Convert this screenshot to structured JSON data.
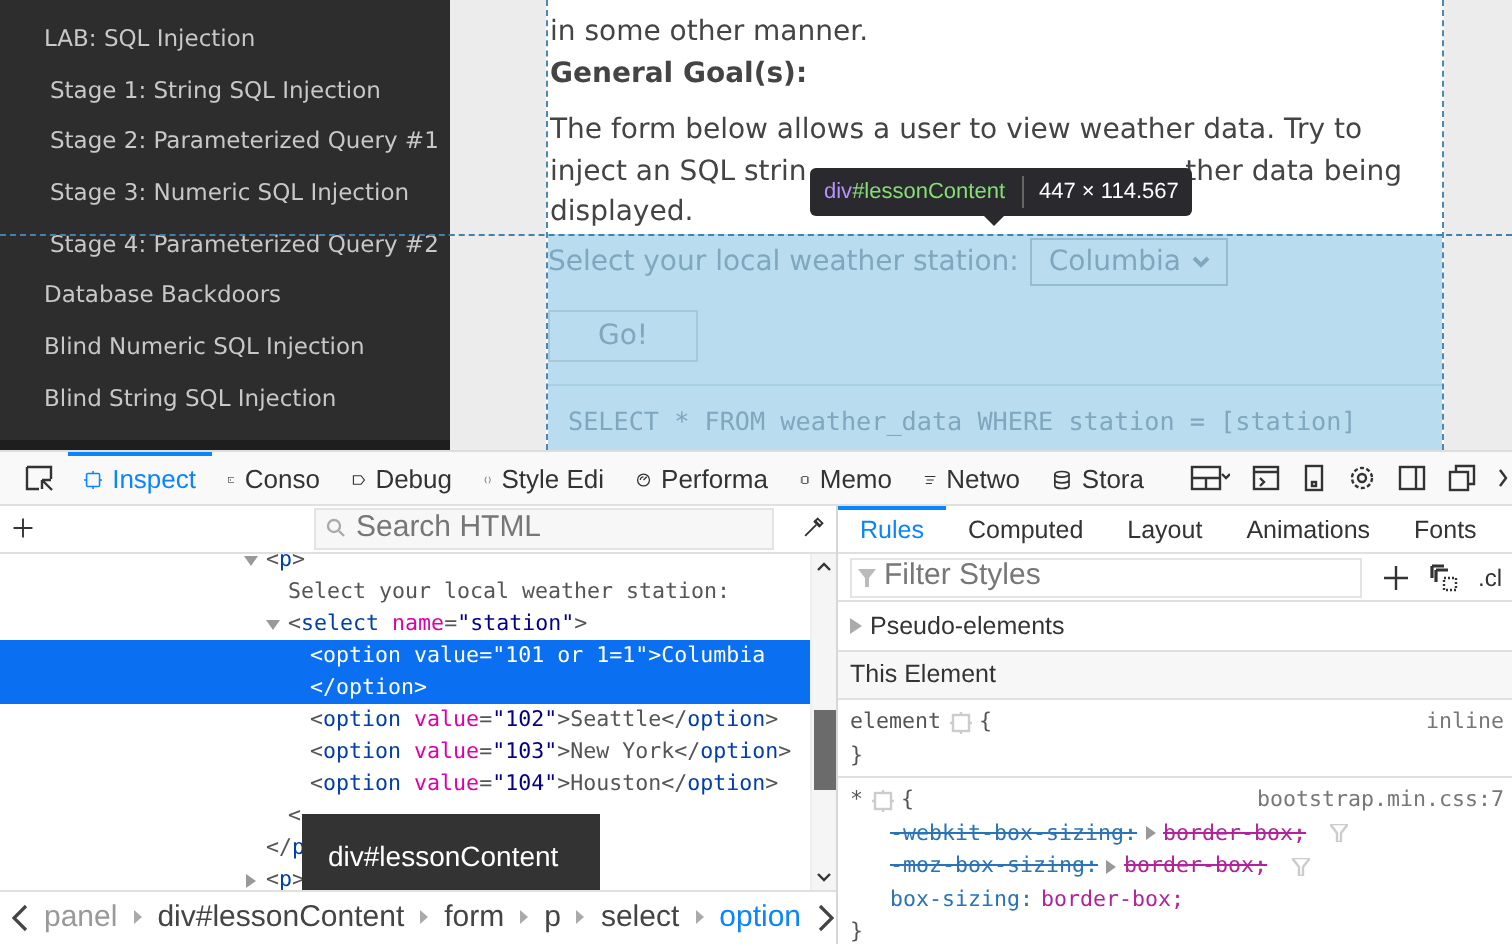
{
  "sidebar": {
    "items": [
      {
        "label": "LAB: SQL Injection",
        "children": [
          {
            "label": "Stage 1: String SQL Injection"
          },
          {
            "label": "Stage 2: Parameterized Query #1"
          },
          {
            "label": "Stage 3: Numeric SQL Injection"
          },
          {
            "label": "Stage 4: Parameterized Query #2"
          }
        ]
      },
      {
        "label": "Database Backdoors"
      },
      {
        "label": "Blind Numeric SQL Injection"
      },
      {
        "label": "Blind String SQL Injection"
      }
    ]
  },
  "lesson": {
    "text": "in some other manner.",
    "heading": "General Goal(s):",
    "paragraph_lines": [
      {
        "left": "The form below allows a user to view weather data. Try to"
      },
      {
        "left": "inject an SQL strin",
        "right": "ther data being"
      },
      {
        "left": "displayed."
      }
    ],
    "form": {
      "highlighted": true,
      "label": "Select your local weather station:",
      "station": "Columbia",
      "button": "Go!",
      "query": "SELECT * FROM weather_data WHERE station = [station]"
    }
  },
  "highlight_tooltip": {
    "tag": "div",
    "id": "#lessonContent",
    "size": "447 × 114.567"
  },
  "devtools": {
    "tabs": [
      {
        "label": "Inspect",
        "selected": true
      },
      {
        "label": "Conso",
        "selected": false
      },
      {
        "label": "Debug",
        "selected": false
      },
      {
        "label": "Style Edi",
        "selected": false
      },
      {
        "label": "Performa",
        "selected": false
      },
      {
        "label": "Memo",
        "selected": false
      },
      {
        "label": "Netwo",
        "selected": false
      },
      {
        "label": "Stora",
        "selected": false
      }
    ],
    "search_placeholder": "Search HTML",
    "markup": [
      {
        "open": "<p>",
        "expanded": true,
        "selected": false,
        "children": [
          {
            "text": "Select your local weather station:",
            "selected": false
          },
          {
            "open": "<select name=\"station\">",
            "expanded": true,
            "selected": false,
            "children": [
              {
                "open": "<option value=\"101 or 1=1\">",
                "content": "Columbia",
                "close_line": "</option>",
                "selected": true
              },
              {
                "open": "<option value=\"102\">",
                "content": "Seattle",
                "close": "</option>",
                "selected": false
              },
              {
                "open": "<option value=\"103\">",
                "content": "New York",
                "close": "</option>",
                "selected": false
              },
              {
                "open": "<option value=\"104\">",
                "content": "Houston",
                "close": "</option>",
                "selected": false
              }
            ],
            "end": "<"
          }
        ],
        "end": "</p"
      },
      {
        "open": "<p>",
        "expanded": false,
        "selected": false
      }
    ],
    "node_tooltip": "div#lessonContent",
    "breadcrumbs": [
      {
        "label": "panel",
        "selected": false
      },
      {
        "label": "div#lessonContent",
        "selected": false
      },
      {
        "label": "form",
        "selected": false
      },
      {
        "label": "p",
        "selected": false
      },
      {
        "label": "select",
        "selected": false
      },
      {
        "label": "option",
        "selected": true
      }
    ],
    "sidebar_tabs": [
      {
        "label": "Rules",
        "selected": true
      },
      {
        "label": "Computed",
        "selected": false
      },
      {
        "label": "Layout",
        "selected": false
      },
      {
        "label": "Animations",
        "selected": false
      },
      {
        "label": "Fonts",
        "selected": false
      }
    ],
    "filter_placeholder": "Filter Styles",
    "class_toggle": ".cl",
    "pseudo_elements": "Pseudo-elements",
    "section": "This Element",
    "rules": [
      {
        "selector": "element",
        "open_brace": "{",
        "source": "inline",
        "close_brace": "}"
      },
      {
        "selector": "*",
        "open_brace": "{",
        "source": "bootstrap.min.css:7",
        "close_brace": "}",
        "declarations": [
          {
            "property": "-webkit-box-sizing:",
            "value": "border-box;",
            "overridden": true
          },
          {
            "property": "-moz-box-sizing:",
            "value": "border-box;",
            "overridden": true
          },
          {
            "property": "box-sizing:",
            "value": "border-box;",
            "overridden": false
          }
        ]
      }
    ]
  }
}
